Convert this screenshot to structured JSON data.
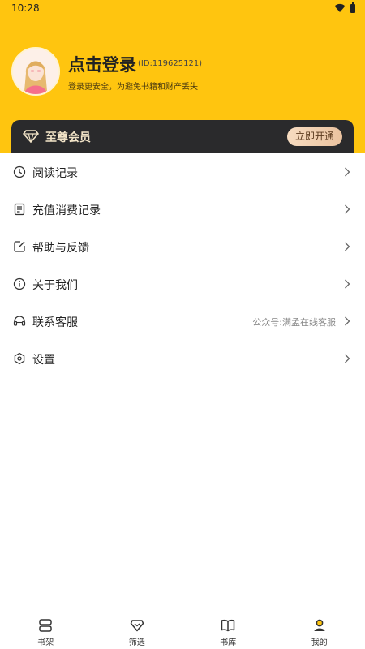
{
  "status_bar": {
    "time": "10:28"
  },
  "profile": {
    "login_title": "点击登录",
    "user_id": "(ID:119625121)",
    "subtitle": "登录更安全，为避免书籍和财产丢失"
  },
  "vip": {
    "label": "至尊会员",
    "button": "立即开通"
  },
  "menu": [
    {
      "label": "阅读记录",
      "icon": "clock-icon"
    },
    {
      "label": "充值消费记录",
      "icon": "receipt-icon"
    },
    {
      "label": "帮助与反馈",
      "icon": "edit-icon"
    },
    {
      "label": "关于我们",
      "icon": "info-icon"
    },
    {
      "label": "联系客服",
      "icon": "headset-icon",
      "extra": "公众号:满孟在线客服"
    },
    {
      "label": "设置",
      "icon": "settings-icon"
    }
  ],
  "tabs": [
    {
      "label": "书架",
      "icon": "bookshelf-icon"
    },
    {
      "label": "筛选",
      "icon": "filter-gem-icon"
    },
    {
      "label": "书库",
      "icon": "book-open-icon"
    },
    {
      "label": "我的",
      "icon": "user-icon",
      "active": true
    }
  ],
  "colors": {
    "header_bg": "#ffc50f",
    "vip_bg": "#2a2a2c",
    "vip_text": "#f1e3c7"
  }
}
